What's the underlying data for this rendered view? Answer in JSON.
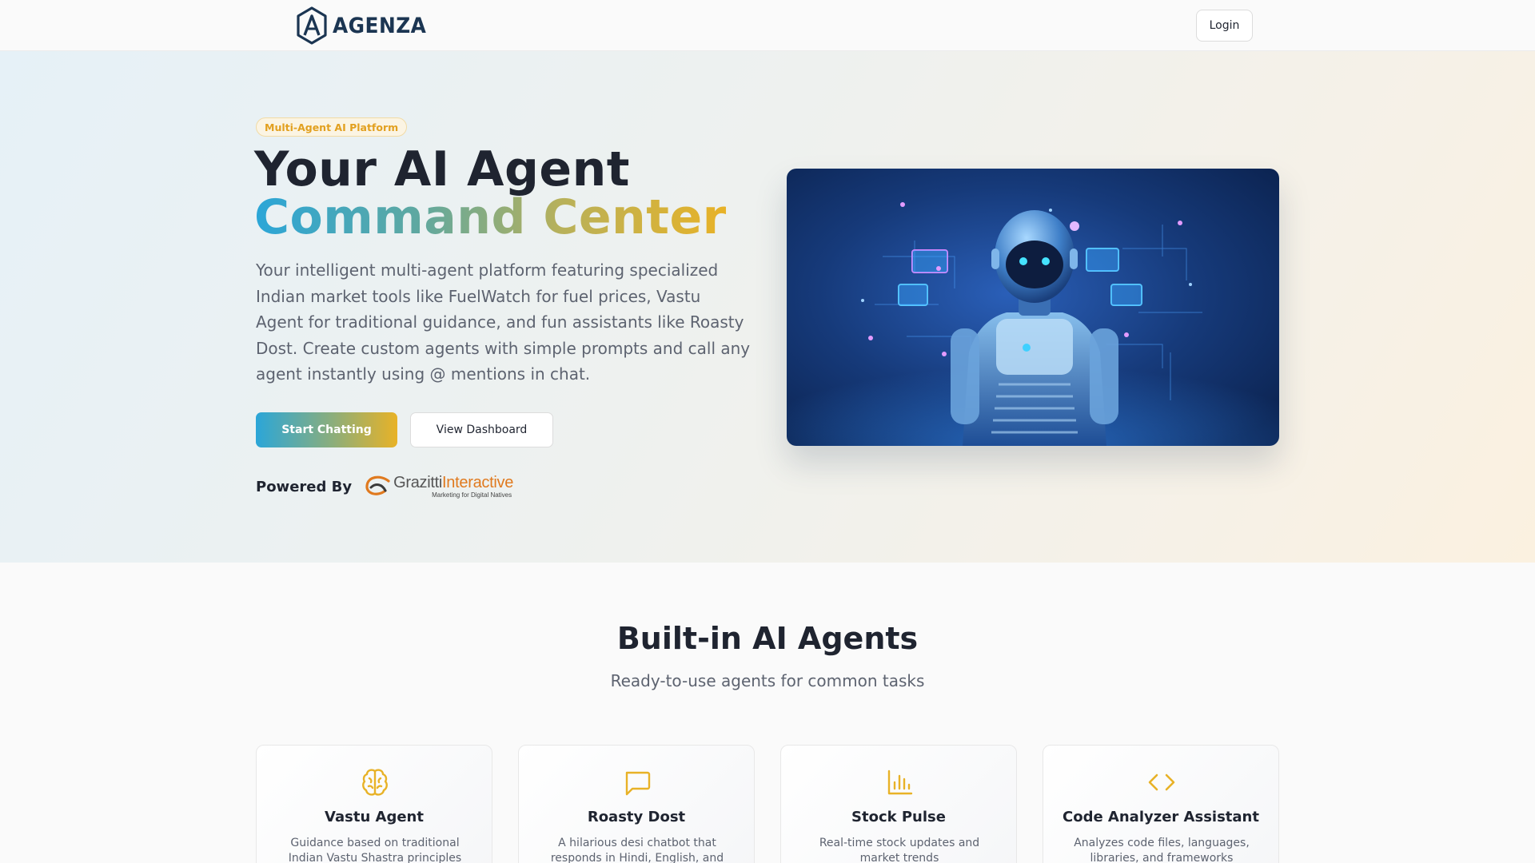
{
  "header": {
    "logo_text": "AGENZA",
    "login_label": "Login"
  },
  "hero": {
    "badge": "Multi-Agent AI Platform",
    "title_line1": "Your AI Agent",
    "title_line2": "Command Center",
    "description": "Your intelligent multi-agent platform featuring specialized Indian market tools like FuelWatch for fuel prices, Vastu Agent for traditional guidance, and fun assistants like Roasty Dost. Create custom agents with simple prompts and call any agent instantly using @ mentions in chat.",
    "primary_button": "Start Chatting",
    "secondary_button": "View Dashboard",
    "powered_by": "Powered By",
    "partner_name_part1": "Grazitti",
    "partner_name_part2": "Interactive",
    "partner_tagline": "Marketing for Digital Natives"
  },
  "agents_section": {
    "title": "Built-in AI Agents",
    "subtitle": "Ready-to-use agents for common tasks",
    "cards": [
      {
        "title": "Vastu Agent",
        "description": "Guidance based on traditional Indian Vastu Shastra principles",
        "icon": "brain-icon"
      },
      {
        "title": "Roasty Dost",
        "description": "A hilarious desi chatbot that responds in Hindi, English, and",
        "icon": "chat-bubble-icon"
      },
      {
        "title": "Stock Pulse",
        "description": "Real-time stock updates and market trends",
        "icon": "bar-chart-icon"
      },
      {
        "title": "Code Analyzer Assistant",
        "description": "Analyzes code files, languages, libraries, and frameworks",
        "icon": "code-icon"
      }
    ]
  },
  "colors": {
    "accent_blue": "#2ba6d8",
    "accent_gold": "#e8b227",
    "brand_navy": "#1b3552",
    "text_dark": "#1f2430",
    "text_muted": "#5d6370"
  }
}
